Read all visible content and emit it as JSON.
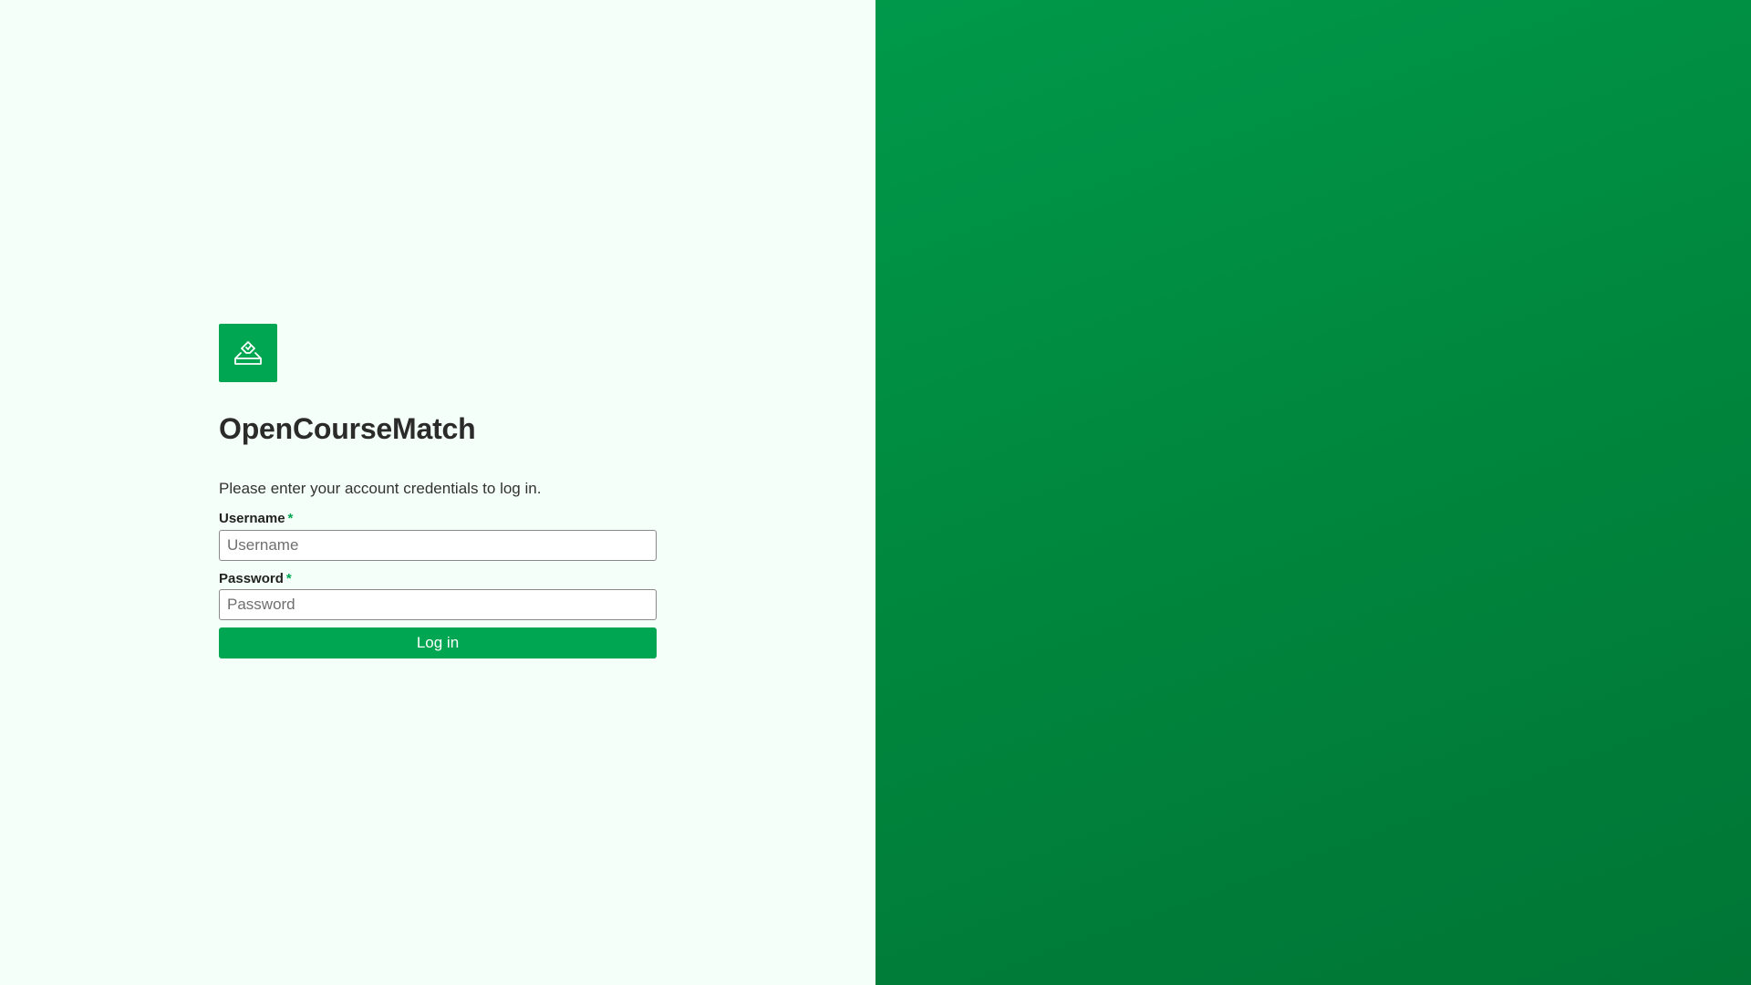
{
  "app": {
    "title": "OpenCourseMatch",
    "logo_icon": "ballot-box-icon"
  },
  "login": {
    "instructions": "Please enter your account credentials to log in.",
    "username": {
      "label": "Username",
      "required_mark": "*",
      "placeholder": "Username",
      "value": ""
    },
    "password": {
      "label": "Password",
      "required_mark": "*",
      "placeholder": "Password",
      "value": ""
    },
    "submit_label": "Log in"
  },
  "colors": {
    "accent": "#00a651",
    "left_background": "#f5fff9",
    "right_gradient_start": "#00994a",
    "right_gradient_end": "#007535"
  }
}
